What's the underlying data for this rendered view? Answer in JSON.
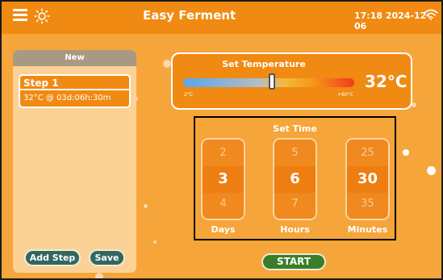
{
  "header": {
    "title": "Easy Ferment",
    "datetime": "17:18 2024-12-06",
    "icons": [
      "menu-icon",
      "sun-icon",
      "wifi-icon"
    ]
  },
  "program_panel": {
    "heading": "New",
    "steps": [
      {
        "title": "Step 1",
        "detail": "32°C @ 03d:06h:30m"
      }
    ],
    "add_step_label": "Add Step",
    "save_label": "Save"
  },
  "temperature": {
    "label": "Set Temperature",
    "min_label": "2°C",
    "max_label": "+60°C",
    "value_text": "32°C",
    "min": 2,
    "max": 60,
    "value": 32
  },
  "time": {
    "label": "Set Time",
    "days": {
      "prev": "2",
      "current": "3",
      "next": "4",
      "unit": "Days"
    },
    "hours": {
      "prev": "5",
      "current": "6",
      "next": "7",
      "unit": "Hours"
    },
    "minutes": {
      "prev": "25",
      "current": "30",
      "next": "35",
      "unit": "Minutes"
    }
  },
  "start_label": "START",
  "colors": {
    "background": "#f5a53a",
    "header": "#f08a12",
    "accent_orange": "#f08a12",
    "panel": "#fcd196",
    "button_dark": "#34665e",
    "start_green": "#3b7d29"
  }
}
